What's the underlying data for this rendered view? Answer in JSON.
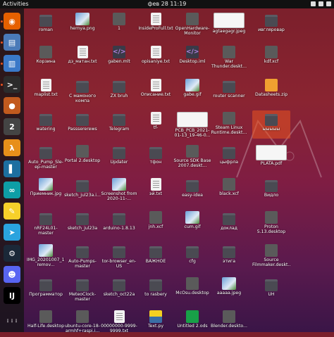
{
  "topbar": {
    "activities": "Activities",
    "clock": "фев 28  11:19"
  },
  "colors": {
    "accent": "#e95420",
    "panel": "#111111"
  },
  "dock": [
    {
      "name": "firefox-icon",
      "color": "#e66000",
      "glyph": "◉"
    },
    {
      "name": "files-icon",
      "color": "#4a7ab8",
      "glyph": "▤"
    },
    {
      "name": "store-icon",
      "color": "#3a79c8",
      "glyph": "▥"
    },
    {
      "name": "terminal-icon",
      "color": "#2c2c2c",
      "glyph": ">_"
    },
    {
      "name": "tf2-icon",
      "color": "#c25a1e",
      "glyph": "●"
    },
    {
      "name": "xonotic-icon",
      "color": "#444",
      "glyph": "2"
    },
    {
      "name": "half-life-icon",
      "color": "#e78f1a",
      "glyph": "λ"
    },
    {
      "name": "vertical-bar-icon",
      "color": "#1d6fa0",
      "glyph": "▌"
    },
    {
      "name": "arduino-icon",
      "color": "#0e9ea6",
      "glyph": "∞"
    },
    {
      "name": "notes-icon",
      "color": "#f7d02a",
      "glyph": "✎"
    },
    {
      "name": "telegram-icon",
      "color": "#2aa3de",
      "glyph": "➤"
    },
    {
      "name": "steam-icon",
      "color": "#1b2838",
      "glyph": "⚙"
    },
    {
      "name": "discord-icon",
      "color": "#5865f2",
      "glyph": "☻"
    },
    {
      "name": "intellij-icon",
      "color": "#000",
      "glyph": "IJ"
    },
    {
      "name": "show-apps-icon",
      "color": "transparent",
      "glyph": "⋮⋮⋮"
    }
  ],
  "items": [
    {
      "label": "roman",
      "type": "folder"
    },
    {
      "label": "hernya.png",
      "type": "img"
    },
    {
      "label": "1",
      "type": "gray"
    },
    {
      "label": "InsideProFull.txt",
      "type": "doc"
    },
    {
      "label": "OpenHardware-Monitor",
      "type": "gray"
    },
    {
      "label": "agtaegagr.jpeg",
      "type": "wide"
    },
    {
      "label": "ивгляровар",
      "type": "folder"
    },
    {
      "label": "Корзина",
      "type": "gray"
    },
    {
      "label": "дз_матан.txt",
      "type": "doc"
    },
    {
      "label": "gaben.mlt",
      "type": "code"
    },
    {
      "label": "opisaniye.txt",
      "type": "doc"
    },
    {
      "label": "Desktop.iml",
      "type": "code"
    },
    {
      "label": "War Thunder.deskt...",
      "type": "gray"
    },
    {
      "label": "kdf.xcf",
      "type": "gray"
    },
    {
      "label": "maplist.txt",
      "type": "doc"
    },
    {
      "label": "С мамоного компа",
      "type": "folder"
    },
    {
      "label": "ZX bruh",
      "type": "folder"
    },
    {
      "label": "Описание.txt",
      "type": "doc"
    },
    {
      "label": "gabe.gif",
      "type": "img"
    },
    {
      "label": "router scanner",
      "type": "folder"
    },
    {
      "label": "Datasheets.zip",
      "type": "orange"
    },
    {
      "label": "watering",
      "type": "folder"
    },
    {
      "label": "Passsererews",
      "type": "folder"
    },
    {
      "label": "Telegram",
      "type": "folder"
    },
    {
      "label": "tf-",
      "type": "doc"
    },
    {
      "label": "PCB_PCB_2021-01-13_19-46-0...",
      "type": "wide"
    },
    {
      "label": "Steam Linux Runtime.deskt...",
      "type": "gray"
    },
    {
      "label": "ыыыыы",
      "type": "folder"
    },
    {
      "label": "Auto_Pump_Sle-ep-master",
      "type": "folder"
    },
    {
      "label": "Portal 2.desktop",
      "type": "gray"
    },
    {
      "label": "Updater",
      "type": "folder"
    },
    {
      "label": "тфон",
      "type": "folder"
    },
    {
      "label": "Source SDK Base 2007.deskt...",
      "type": "gray"
    },
    {
      "label": "цыфрла",
      "type": "folder"
    },
    {
      "label": "PLATA.pdf",
      "type": "wide"
    },
    {
      "label": "Приемник.jpg",
      "type": "img"
    },
    {
      "label": "sketch_jul23a.i...",
      "type": "folder"
    },
    {
      "label": "Screenshot from 2020-11-...",
      "type": "img"
    },
    {
      "label": "эй.txt",
      "type": "doc"
    },
    {
      "label": "easy-idea",
      "type": "folder"
    },
    {
      "label": "black.xcf",
      "type": "gray"
    },
    {
      "label": "Видло",
      "type": "folder"
    },
    {
      "label": "nRF24L01-master",
      "type": "folder"
    },
    {
      "label": "sketch_jul23a",
      "type": "folder"
    },
    {
      "label": "arduino-1.8.13",
      "type": "folder"
    },
    {
      "label": "jnh.xcf",
      "type": "gray"
    },
    {
      "label": "cum.gif",
      "type": "img"
    },
    {
      "label": "доклад",
      "type": "folder"
    },
    {
      "label": "Proton 5.13.desktop",
      "type": "gray"
    },
    {
      "label": "IMG_20201007_151329-remov...",
      "type": "img"
    },
    {
      "label": "Auto-Pumps-master",
      "type": "folder"
    },
    {
      "label": "tor-browser_en-US",
      "type": "folder"
    },
    {
      "label": "ВАЖНОЕ",
      "type": "folder"
    },
    {
      "label": "cfg",
      "type": "folder"
    },
    {
      "label": "этига",
      "type": "folder"
    },
    {
      "label": "Source Filmmaker.deskt...",
      "type": "gray"
    },
    {
      "label": "Программатор",
      "type": "folder"
    },
    {
      "label": "MeteoClock-master",
      "type": "folder"
    },
    {
      "label": "sketch_oct22a",
      "type": "folder"
    },
    {
      "label": "to rasbery",
      "type": "folder"
    },
    {
      "label": "McOsu.desktop",
      "type": "gray"
    },
    {
      "label": "ааааа.jpeg",
      "type": "img"
    },
    {
      "label": "UH",
      "type": "folder"
    },
    {
      "label": "Half-Life.desktop",
      "type": "gray"
    },
    {
      "label": "ubuntu-core-18-armhf+raspi.i...",
      "type": "gray"
    },
    {
      "label": "00000000-9999-9999.txt",
      "type": "doc"
    },
    {
      "label": "Text.py",
      "type": "py"
    },
    {
      "label": "Untitled 2.ods",
      "type": "ods"
    },
    {
      "label": "Blender.deskto...",
      "type": "gray"
    },
    {
      "label": "",
      "type": "none"
    }
  ]
}
